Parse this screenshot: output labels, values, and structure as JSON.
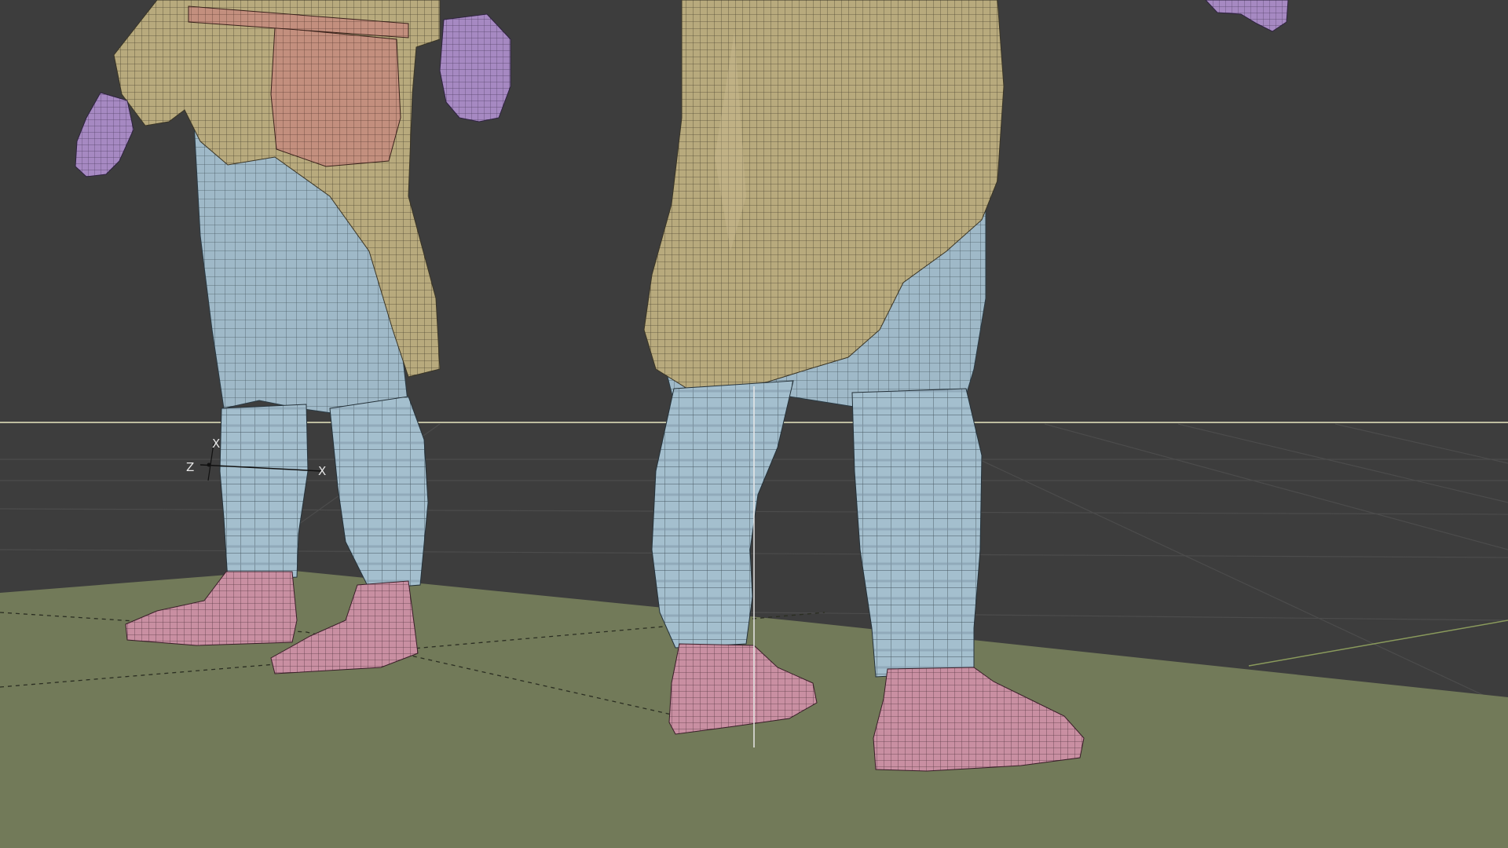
{
  "viewport": {
    "axis_labels": {
      "z": "Z",
      "x": "X",
      "x_secondary": "X"
    },
    "colors": {
      "background": "#3d3d3d",
      "grid": "#4a4a4a",
      "ground_plane": "#727a59",
      "horizon_line": "#e8e6c0",
      "cursor_line": "#e8e8e8",
      "coat": "#b8aa7d",
      "trousers": "#9fb9c8",
      "puttees": "#9fb9c8",
      "boots": "#c98fa2",
      "hands": "#a689c2",
      "pouch": "#c38f7e",
      "wire": "#2a2a2a"
    }
  }
}
